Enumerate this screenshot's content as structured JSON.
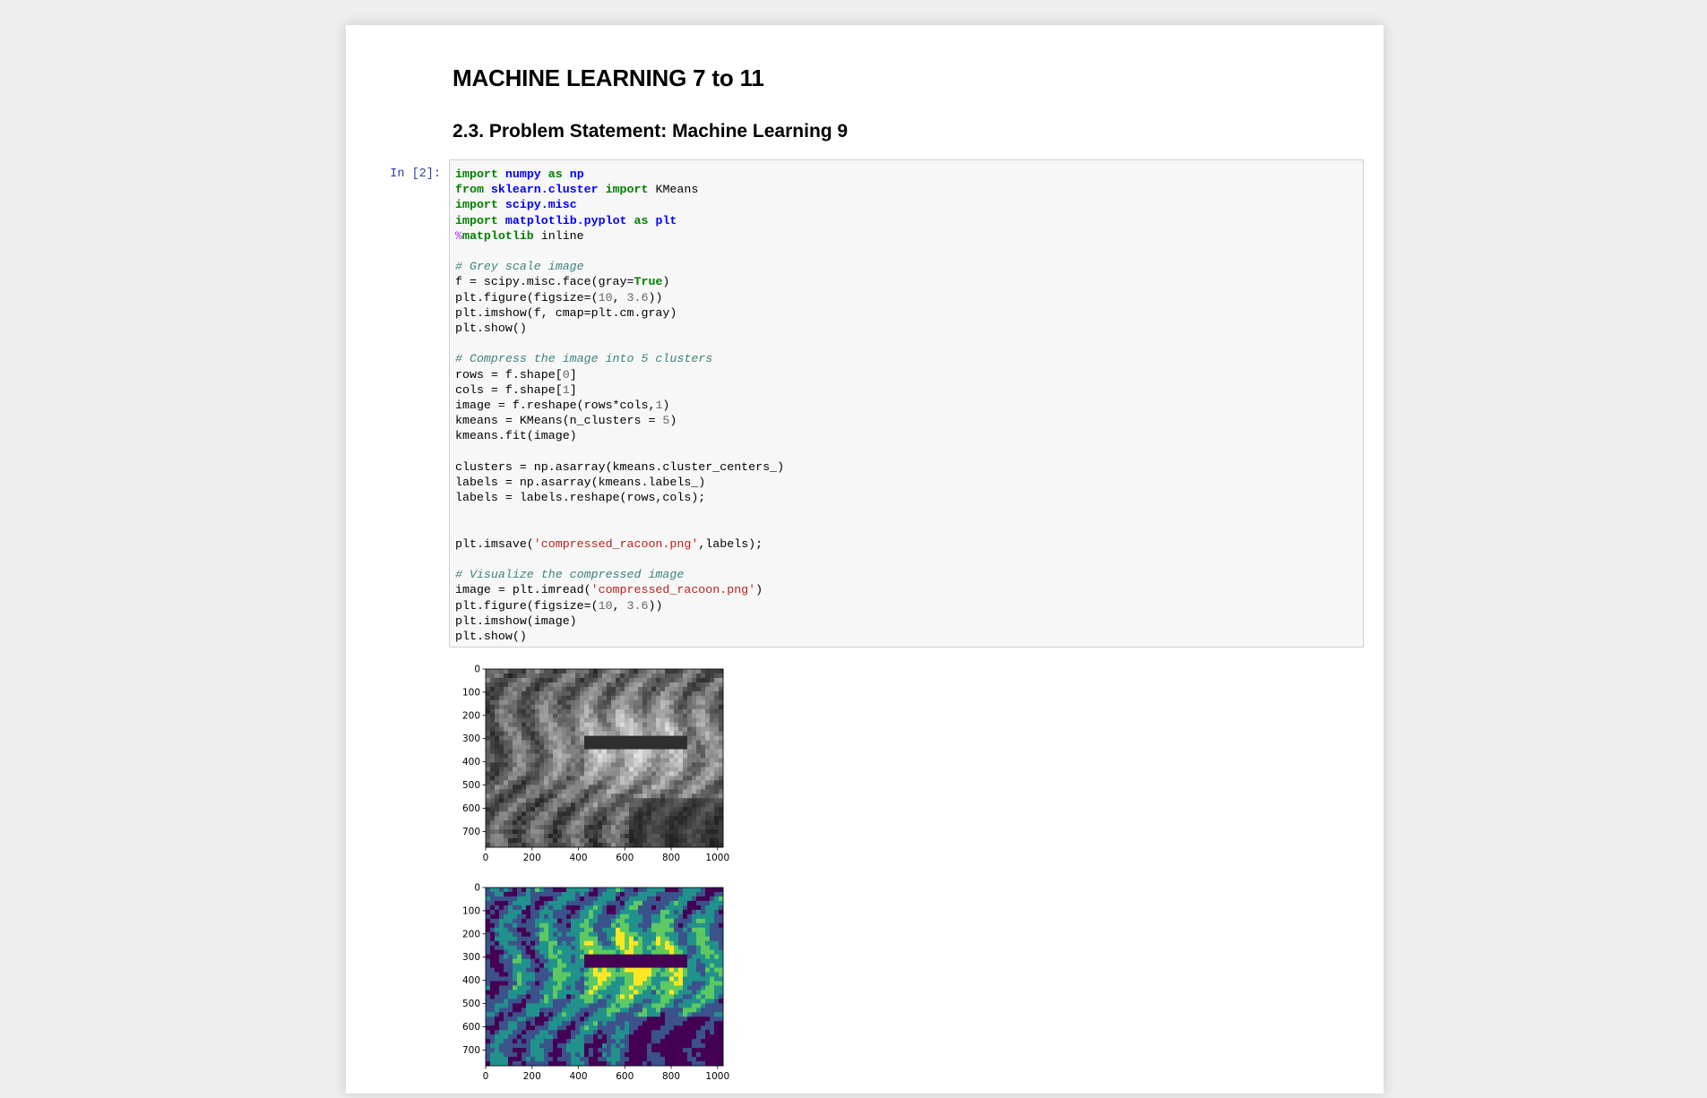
{
  "notebook": {
    "title": "MACHINE LEARNING 7 to 11",
    "section_heading": "2.3. Problem Statement: Machine Learning 9",
    "cell": {
      "prompt": "In [2]:",
      "code_lines": [
        "import numpy as np",
        "from sklearn.cluster import KMeans",
        "import scipy.misc",
        "import matplotlib.pyplot as plt",
        "%matplotlib inline",
        "",
        "# Grey scale image",
        "f = scipy.misc.face(gray=True)",
        "plt.figure(figsize=(10, 3.6))",
        "plt.imshow(f, cmap=plt.cm.gray)",
        "plt.show()",
        "",
        "# Compress the image into 5 clusters",
        "rows = f.shape[0]",
        "cols = f.shape[1]",
        "image = f.reshape(rows*cols,1)",
        "kmeans = KMeans(n_clusters = 5)",
        "kmeans.fit(image)",
        "",
        "clusters = np.asarray(kmeans.cluster_centers_)",
        "labels = np.asarray(kmeans.labels_)",
        "labels = labels.reshape(rows,cols);",
        "",
        "",
        "plt.imsave('compressed_racoon.png',labels);",
        "",
        "# Visualize the compressed image",
        "image = plt.imread('compressed_racoon.png')",
        "plt.figure(figsize=(10, 3.6))",
        "plt.imshow(image)",
        "plt.show()"
      ]
    },
    "outputs": [
      {
        "name": "grayscale-raccoon",
        "y_ticks": [
          "0",
          "100",
          "200",
          "300",
          "400",
          "500",
          "600",
          "700"
        ],
        "x_ticks": [
          "0",
          "200",
          "400",
          "600",
          "800",
          "1000"
        ],
        "colormap": "gray"
      },
      {
        "name": "compressed-raccoon",
        "y_ticks": [
          "0",
          "100",
          "200",
          "300",
          "400",
          "500",
          "600",
          "700"
        ],
        "x_ticks": [
          "0",
          "200",
          "400",
          "600",
          "800",
          "1000"
        ],
        "colormap": "viridis",
        "palette": [
          "#440154",
          "#3b528b",
          "#21918c",
          "#5ec962",
          "#fde725"
        ]
      }
    ]
  }
}
